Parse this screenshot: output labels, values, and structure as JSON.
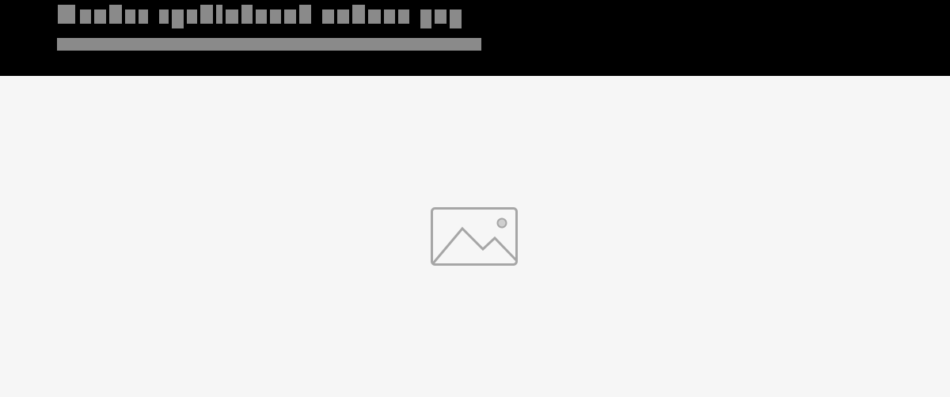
{
  "header": {
    "title_placeholder": "redacted-title",
    "subtitle_placeholder": "redacted-subtitle"
  },
  "main": {
    "image_placeholder": {
      "icon": "image-icon"
    }
  },
  "colors": {
    "header_background": "#000000",
    "title_redaction": "#8a8a8a",
    "subtitle_redaction": "#8a8a8a",
    "canvas_background": "#f6f6f6",
    "icon_stroke": "#a6a6a6"
  }
}
